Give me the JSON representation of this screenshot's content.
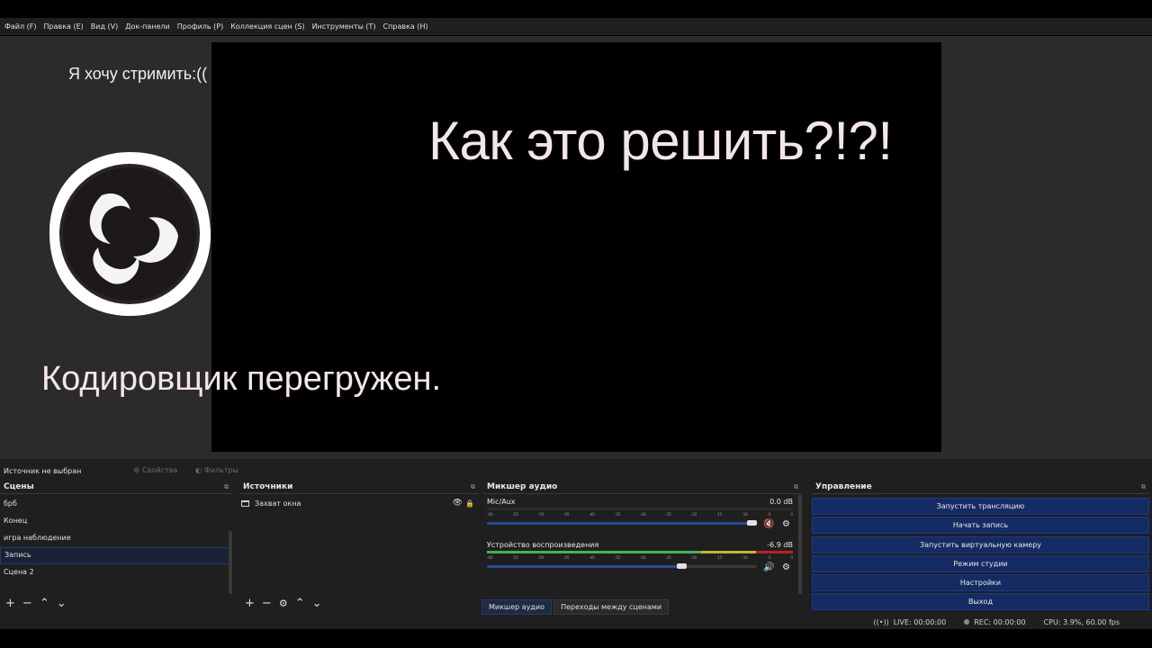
{
  "menubar": {
    "items": [
      "Файл (F)",
      "Правка (E)",
      "Вид (V)",
      "Док-панели",
      "Профиль (P)",
      "Коллекция сцен (S)",
      "Инструменты (T)",
      "Справка (H)"
    ]
  },
  "preview": {
    "overlay_small": "Я хочу стримить:((",
    "overlay_big": "Как это решить?!?!",
    "overlay_med": "Кодировщик перегружен."
  },
  "context_bar": {
    "no_source": "Источник не выбран",
    "properties": "Свойства",
    "filters": "Фильтры"
  },
  "scenes": {
    "title": "Сцены",
    "items": [
      "брб",
      "Конец",
      "игра наблюдение",
      "Запись",
      "Сцена 2"
    ],
    "active_index": 3
  },
  "sources": {
    "title": "Источники",
    "items": [
      "Захват окна"
    ]
  },
  "mixer": {
    "title": "Микшер аудио",
    "ticks": [
      "-60",
      "-55",
      "-50",
      "-45",
      "-40",
      "-35",
      "-30",
      "-25",
      "-20",
      "-15",
      "-10",
      "-5",
      "0"
    ],
    "channels": [
      {
        "name": "Mic/Aux",
        "db": "0.0 dB",
        "level_fraction": 0.0,
        "volume_fraction": 1.0,
        "muted": true
      },
      {
        "name": "Устройство воспроизведения",
        "db": "-6.9 dB",
        "level_fraction": 1.0,
        "volume_fraction": 0.72,
        "muted": false
      }
    ],
    "tabs": [
      "Микшер аудио",
      "Переходы между сценами"
    ]
  },
  "controls": {
    "title": "Управление",
    "buttons": [
      "Запустить трансляцию",
      "Начать запись",
      "Запустить виртуальную камеру",
      "Режим студии",
      "Настройки",
      "Выход"
    ]
  },
  "status": {
    "live": "LIVE: 00:00:00",
    "rec": "REC: 00:00:00",
    "cpu": "CPU: 3.9%, 60.00 fps"
  },
  "colors": {
    "accent": "#152b63",
    "preview_bg": "#000000",
    "muted_icon": "#e02b2b"
  }
}
